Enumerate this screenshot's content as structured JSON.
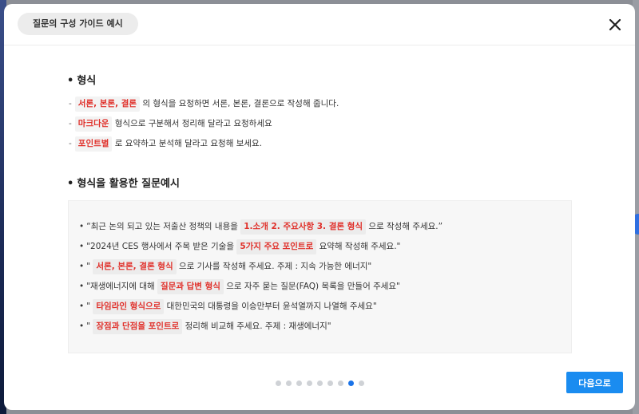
{
  "modal": {
    "title": "질문의 구성 가이드 예시",
    "close_icon": "close-icon"
  },
  "format_section": {
    "title": "형식",
    "items": [
      {
        "highlight": "서론, 본론, 결론",
        "text": " 의 형식을 요청하면 서론, 본론, 결론으로 작성해 줍니다."
      },
      {
        "highlight": "마크다운",
        "text": " 형식으로 구분해서 정리해 달라고 요청하세요"
      },
      {
        "highlight": "포인트별",
        "text": " 로 요약하고 분석해 달라고 요청해 보세요."
      }
    ]
  },
  "examples_section": {
    "title": "형식을 활용한 질문예시",
    "items": [
      {
        "before": "“최근 논의 되고 있는 저출산 정책의 내용을 ",
        "highlight": "1.소개 2. 주요사항 3. 결론 형식",
        "after": " 으로 작성해 주세요.”"
      },
      {
        "before": "\"2024년 CES 행사에서 주목 받은 기술을 ",
        "highlight": "5가지 주요 포인트로",
        "after": " 요약해 작성해 주세요.\""
      },
      {
        "before": "\" ",
        "highlight": "서론, 본론, 결론 형식",
        "after": " 으로 기사를 작성해 주세요. 주제 : 지속 가능한 에너지\""
      },
      {
        "before": "\"재생에너지에 대해 ",
        "highlight": "질문과 답변 형식",
        "after": " 으로 자주 묻는 질문(FAQ) 목록을 만들어 주세요\""
      },
      {
        "before": "\" ",
        "highlight": "타임라인 형식으로",
        "after": " 대한민국의 대통령을 이승만부터 윤석열까지 나열해 주세요\""
      },
      {
        "before": "\" ",
        "highlight": "장점과 단점을 포인트로",
        "after": " 정리해 비교해 주세요. 주제 : 재생에너지\""
      }
    ]
  },
  "pagination": {
    "total": 9,
    "current": 8
  },
  "footer": {
    "next_label": "다음으로"
  },
  "colors": {
    "highlight_text": "#e0302a",
    "accent": "#1a8cf0",
    "active_dot": "#1a73e8"
  }
}
